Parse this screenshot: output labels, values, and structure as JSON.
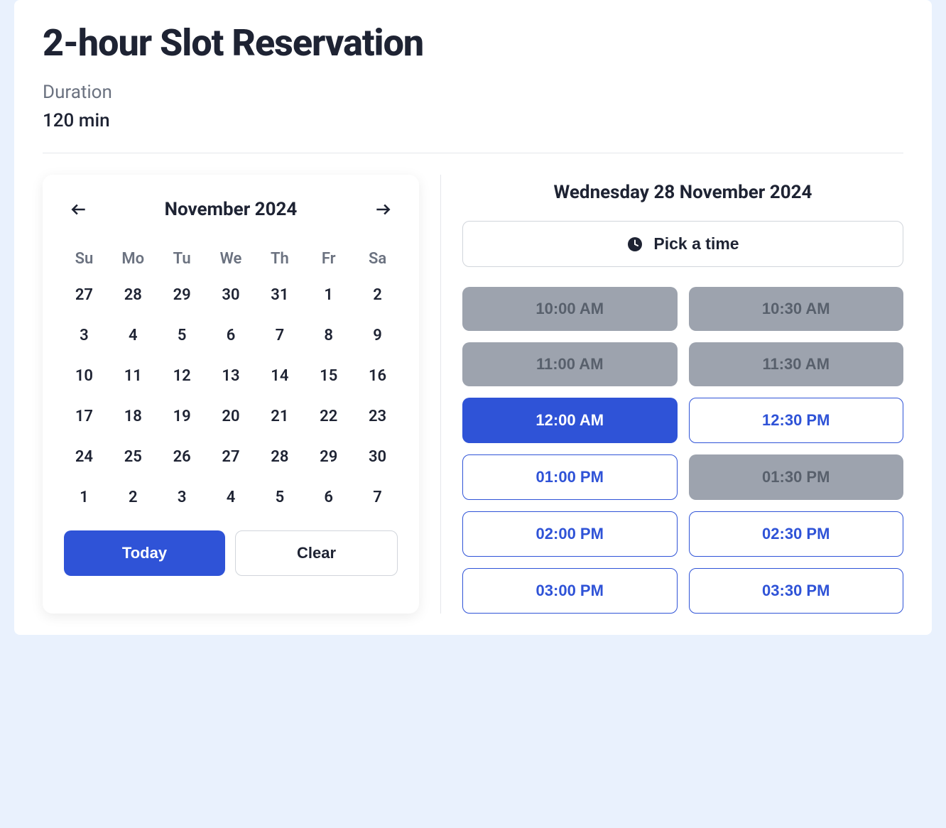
{
  "header": {
    "title": "2-hour Slot Reservation",
    "duration_label": "Duration",
    "duration_value": "120 min"
  },
  "calendar": {
    "month_title": "November 2024",
    "weekdays": [
      "Su",
      "Mo",
      "Tu",
      "We",
      "Th",
      "Fr",
      "Sa"
    ],
    "weeks": [
      [
        "27",
        "28",
        "29",
        "30",
        "31",
        "1",
        "2"
      ],
      [
        "3",
        "4",
        "5",
        "6",
        "7",
        "8",
        "9"
      ],
      [
        "10",
        "11",
        "12",
        "13",
        "14",
        "15",
        "16"
      ],
      [
        "17",
        "18",
        "19",
        "20",
        "21",
        "22",
        "23"
      ],
      [
        "24",
        "25",
        "26",
        "27",
        "28",
        "29",
        "30"
      ],
      [
        "1",
        "2",
        "3",
        "4",
        "5",
        "6",
        "7"
      ]
    ],
    "today_label": "Today",
    "clear_label": "Clear"
  },
  "time_panel": {
    "selected_date": "Wednesday 28 November 2024",
    "pick_label": "Pick a time",
    "slots": [
      {
        "label": "10:00 AM",
        "state": "disabled"
      },
      {
        "label": "10:30 AM",
        "state": "disabled"
      },
      {
        "label": "11:00 AM",
        "state": "disabled"
      },
      {
        "label": "11:30 AM",
        "state": "disabled"
      },
      {
        "label": "12:00 AM",
        "state": "selected"
      },
      {
        "label": "12:30 PM",
        "state": "available"
      },
      {
        "label": "01:00 PM",
        "state": "available"
      },
      {
        "label": "01:30 PM",
        "state": "disabled"
      },
      {
        "label": "02:00 PM",
        "state": "available"
      },
      {
        "label": "02:30 PM",
        "state": "available"
      },
      {
        "label": "03:00 PM",
        "state": "available"
      },
      {
        "label": "03:30 PM",
        "state": "available"
      }
    ]
  }
}
